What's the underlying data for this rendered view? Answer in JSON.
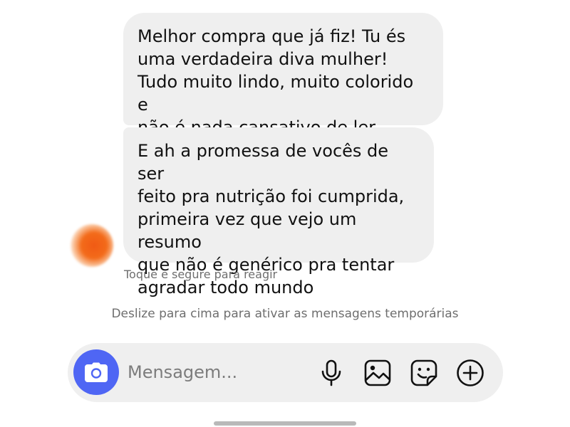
{
  "messages": [
    {
      "text": "Melhor compra que já fiz! Tu és\numa verdadeira diva mulher!\nTudo muito lindo, muito colorido e\nnão é nada cansativo de ler"
    },
    {
      "text": "E ah a promessa de vocês de ser\nfeito pra nutrição foi cumprida,\nprimeira vez que vejo um resumo\nque não é genérico pra tentar\nagradar todo mundo"
    }
  ],
  "hints": {
    "react": "Toque e segure para reagir",
    "vanish_mode": "Deslize para cima para ativar as mensagens temporárias"
  },
  "composer": {
    "placeholder": "Mensagem...",
    "camera_icon": "camera-icon",
    "mic_icon": "microphone-icon",
    "gallery_icon": "gallery-icon",
    "sticker_icon": "sticker-icon",
    "plus_icon": "plus-circle-icon"
  },
  "colors": {
    "bubble_background": "#efefef",
    "camera_button": "#4f66f4",
    "hint_text": "#6e6e6e",
    "avatar": "#f05a14"
  }
}
